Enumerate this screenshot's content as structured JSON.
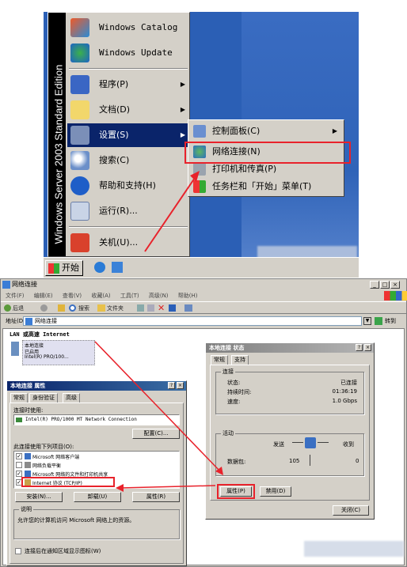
{
  "start_menu": {
    "edition_banner": "Windows Server 2003 Standard Edition",
    "items": [
      {
        "label": "Windows Catalog",
        "icon": "windows-catalog-icon"
      },
      {
        "label": "Windows Update",
        "icon": "windows-update-icon"
      },
      {
        "label": "程序(P)",
        "icon": "programs-icon"
      },
      {
        "label": "文档(D)",
        "icon": "documents-icon"
      },
      {
        "label": "设置(S)",
        "icon": "settings-icon"
      },
      {
        "label": "搜索(C)",
        "icon": "search-icon"
      },
      {
        "label": "帮助和支持(H)",
        "icon": "help-icon"
      },
      {
        "label": "运行(R)...",
        "icon": "run-icon"
      },
      {
        "label": "关机(U)...",
        "icon": "shutdown-icon"
      }
    ],
    "arrow": "▶"
  },
  "settings_submenu": {
    "items": [
      {
        "label": "控制面板(C)",
        "icon": "control-panel-icon"
      },
      {
        "label": "网络连接(N)",
        "icon": "network-connections-icon"
      },
      {
        "label": "打印机和传真(P)",
        "icon": "printers-icon"
      },
      {
        "label": "任务栏和「开始」菜单(T)",
        "icon": "taskbar-icon"
      }
    ]
  },
  "taskbar": {
    "start_label": "开始",
    "quicklaunch": [
      "ie-icon",
      "ie-icon-2"
    ]
  },
  "explorer": {
    "title": "网络连接",
    "menu": [
      "文件(F)",
      "编辑(E)",
      "查看(V)",
      "收藏(A)",
      "工具(T)",
      "高级(N)",
      "帮助(H)"
    ],
    "toolbar": {
      "back": "后退",
      "search": "搜索",
      "folders": "文件夹"
    },
    "address_label": "地址(D)",
    "address_value": "网络连接",
    "go_label": "转到",
    "section": "LAN 或高速 Internet",
    "connection": {
      "name": "本地连接",
      "status": "已启用",
      "device": "Intel(R) PRO/100..."
    }
  },
  "properties_dialog": {
    "title": "本地连接 属性",
    "tabs": [
      "常规",
      "身份验证",
      "高级"
    ],
    "connect_using_label": "连接时使用:",
    "adapter": "Intel(R) PRO/1000 MT Network Connection",
    "configure_button": "配置(C)...",
    "items_label": "此连接使用下列项目(O):",
    "components": [
      {
        "label": "Microsoft 网络客户端",
        "checked": true
      },
      {
        "label": "网络负载平衡",
        "checked": false
      },
      {
        "label": "Microsoft 网络的文件和打印机共享",
        "checked": true
      },
      {
        "label": "Internet 协议 (TCP/IP)",
        "checked": true
      }
    ],
    "install_button": "安装(N)...",
    "uninstall_button": "卸载(U)",
    "properties_button": "属性(R)",
    "description_label": "说明",
    "description": "允许您的计算机访问 Microsoft 网络上的资源。",
    "notify_checkbox": "连接后在通知区域显示图标(W)"
  },
  "status_dialog": {
    "title": "本地连接 状态",
    "tabs": [
      "常规",
      "支持"
    ],
    "connection_label": "连接",
    "rows": [
      {
        "label": "状态:",
        "value": "已连接"
      },
      {
        "label": "持续时间:",
        "value": "01:36:19"
      },
      {
        "label": "速度:",
        "value": "1.0 Gbps"
      }
    ],
    "activity_label": "活动",
    "sent_label": "发送",
    "received_label": "收到",
    "packets_label": "数据包:",
    "packets_sent": "105",
    "packets_received": "0",
    "properties_button": "属性(P)",
    "disable_button": "禁用(D)",
    "close_button": "关闭(C)"
  },
  "colors": {
    "accent_red": "#e8222b",
    "selection": "#0a246a"
  }
}
